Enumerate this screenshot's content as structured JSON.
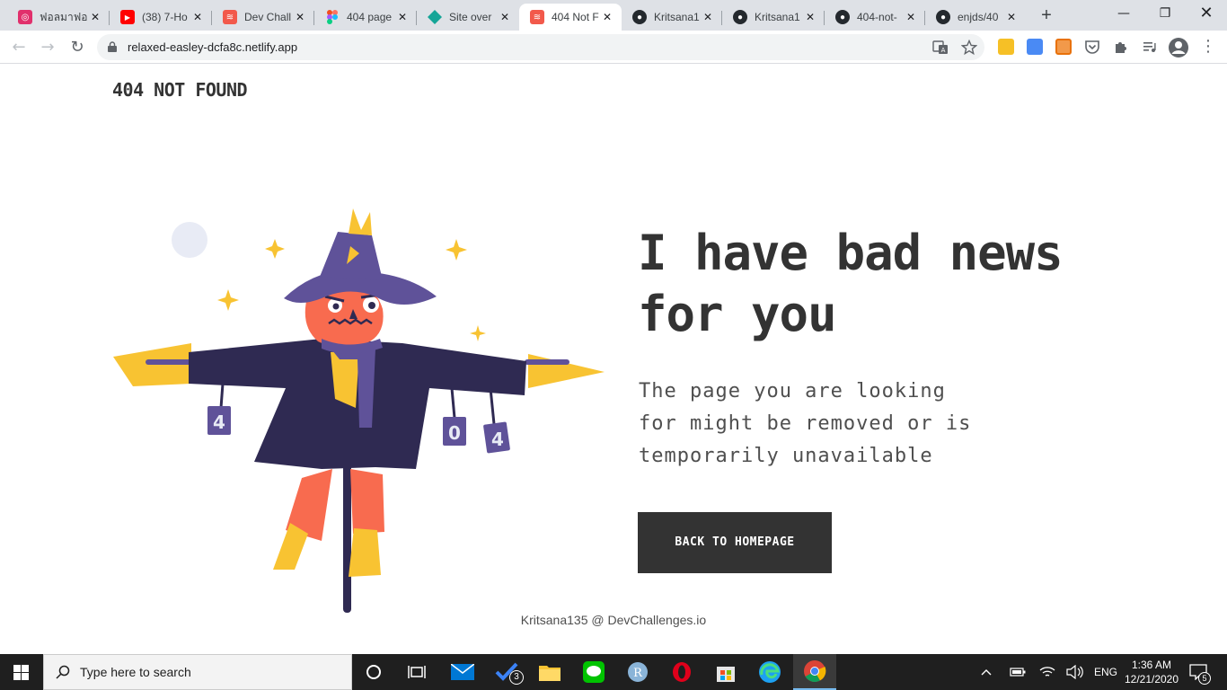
{
  "browser": {
    "tabs": [
      {
        "label": "ฟอลมาฟอล",
        "icon": "instagram-icon",
        "color": "#e1306c"
      },
      {
        "label": "(38) 7-Ho",
        "icon": "youtube-icon",
        "color": "#ff0000"
      },
      {
        "label": "Dev Chall",
        "icon": "devchallenges-icon",
        "color": "#f2594b"
      },
      {
        "label": "404 page",
        "icon": "figma-icon",
        "color": "#a259ff"
      },
      {
        "label": "Site over",
        "icon": "netlify-icon",
        "color": "#15a597"
      },
      {
        "label": "404 Not F",
        "icon": "devchallenges-icon",
        "color": "#f2594b"
      },
      {
        "label": "Kritsana1",
        "icon": "github-icon",
        "color": "#24292e"
      },
      {
        "label": "Kritsana1",
        "icon": "github-icon",
        "color": "#24292e"
      },
      {
        "label": "404-not-",
        "icon": "github-icon",
        "color": "#24292e"
      },
      {
        "label": "enjds/40",
        "icon": "github-icon",
        "color": "#24292e"
      }
    ],
    "active_tab": 5,
    "new_tab": "+",
    "url": "relaxed-easley-dcfa8c.netlify.app"
  },
  "page": {
    "logo": "404 NOT FOUND",
    "headline_line1": "I have bad news",
    "headline_line2": "for you",
    "sub_line1": "The page you are looking",
    "sub_line2": "for might be removed or is",
    "sub_line3": "temporarily unavailable",
    "cta": "BACK TO HOMEPAGE",
    "footer": "Kritsana135 @ DevChallenges.io",
    "can_labels": [
      "4",
      "0",
      "4"
    ],
    "colors": {
      "text": "#333333",
      "button": "#333333",
      "hat": "#5f5299",
      "coat": "#2f2a52",
      "face": "#f86b4f",
      "straw": "#f8c332"
    }
  },
  "taskbar": {
    "search_placeholder": "Type here to search",
    "lang": "ENG",
    "time": "1:36 AM",
    "date": "12/21/2020",
    "notif_count": "5",
    "todo_badge": "3"
  }
}
